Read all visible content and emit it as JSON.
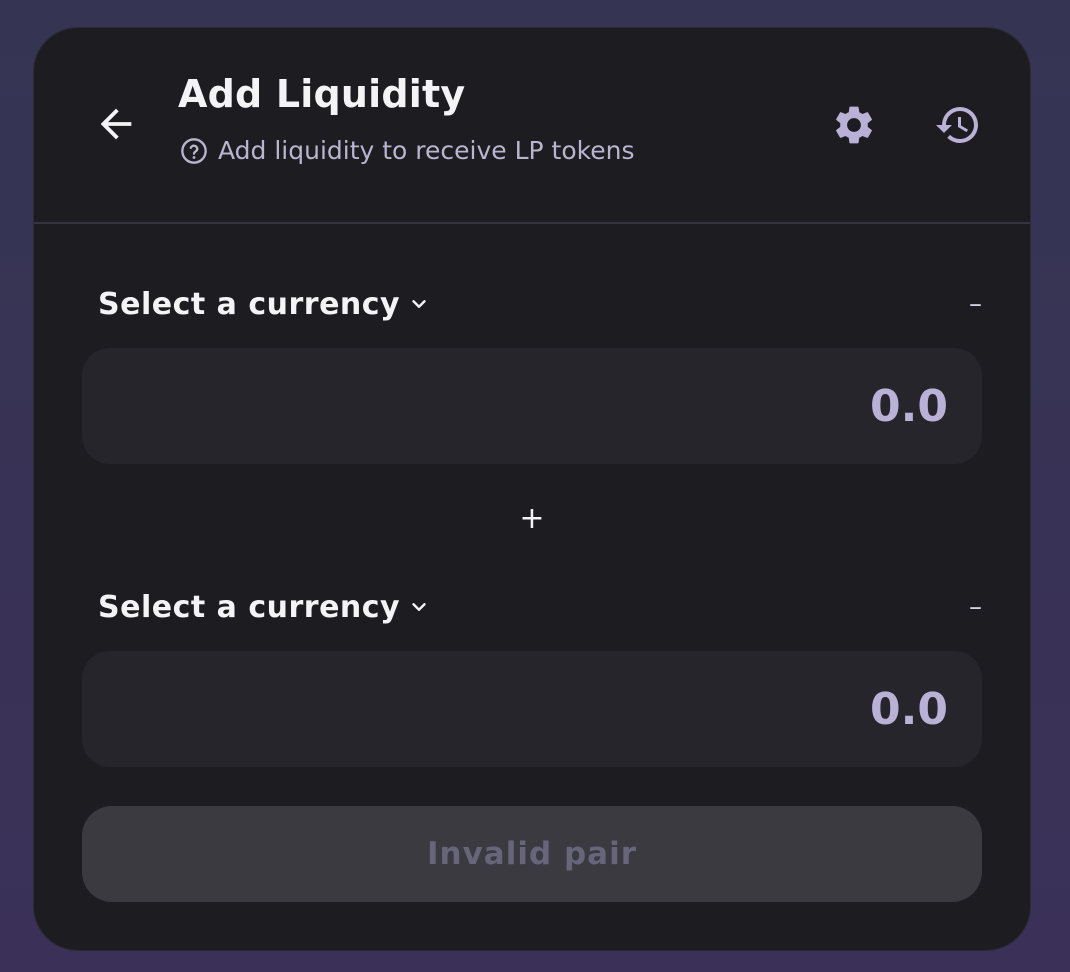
{
  "header": {
    "title": "Add Liquidity",
    "subtitle": "Add liquidity to receive LP tokens",
    "icons": {
      "back": "arrow-left-icon",
      "help": "question-circle-icon",
      "settings": "gear-icon",
      "history": "history-icon"
    }
  },
  "input_a": {
    "currency_label": "Select a currency",
    "balance": "–",
    "placeholder": "0.0",
    "value": ""
  },
  "separator": "+",
  "input_b": {
    "currency_label": "Select a currency",
    "balance": "–",
    "placeholder": "0.0",
    "value": ""
  },
  "submit": {
    "label": "Invalid pair",
    "disabled": true
  },
  "colors": {
    "background": "#353553",
    "card": "#1d1d21",
    "input_bg": "#25252b",
    "accent": "#b9b1d6",
    "text": "#f4f4f6",
    "disabled_button": "#3b3a41",
    "disabled_text": "#67657a"
  }
}
